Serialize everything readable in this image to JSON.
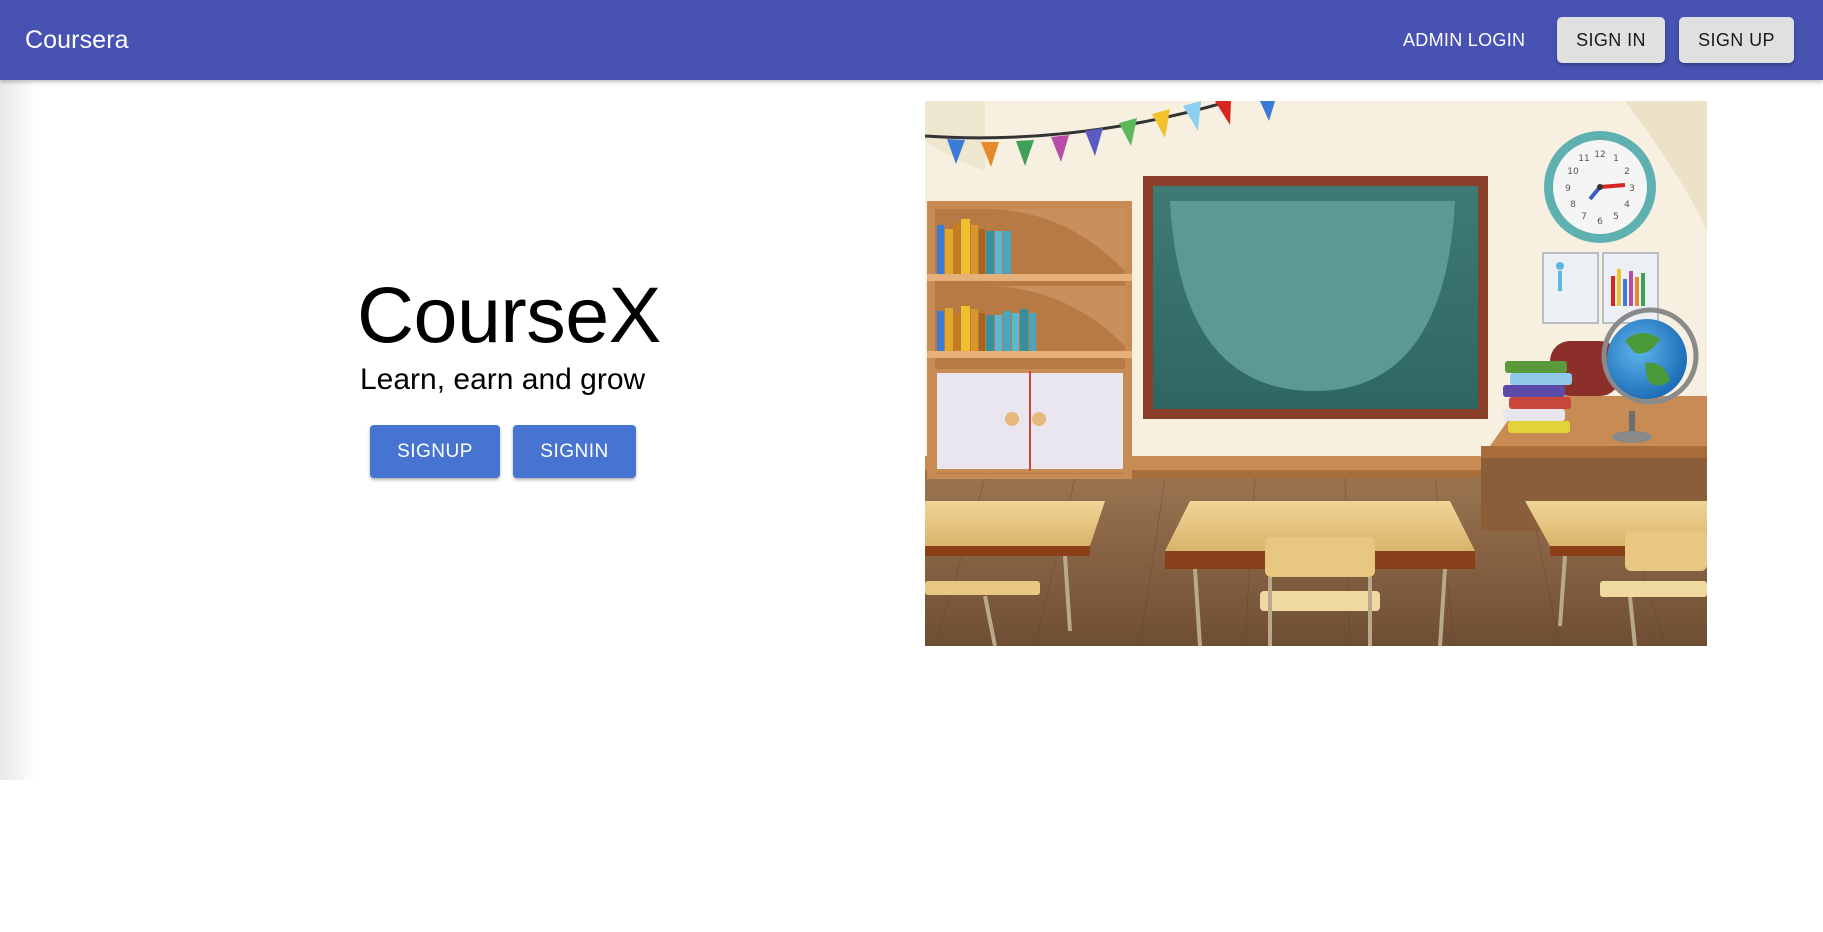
{
  "appbar": {
    "brand": "Coursera",
    "admin_login": "ADMIN LOGIN",
    "sign_in": "SIGN IN",
    "sign_up": "SIGN UP"
  },
  "hero": {
    "title": "CourseX",
    "subtitle": "Learn, earn and grow",
    "signup_label": "SIGNUP",
    "signin_label": "SIGNIN"
  },
  "illustration": {
    "subject": "classroom-illustration",
    "clock_numbers": [
      "12",
      "1",
      "2",
      "3",
      "4",
      "5",
      "6",
      "7",
      "8",
      "9",
      "10",
      "11"
    ]
  },
  "colors": {
    "appbar": "#4752b3",
    "primary_button": "#4774d1",
    "nav_button": "#e0e0e0"
  }
}
